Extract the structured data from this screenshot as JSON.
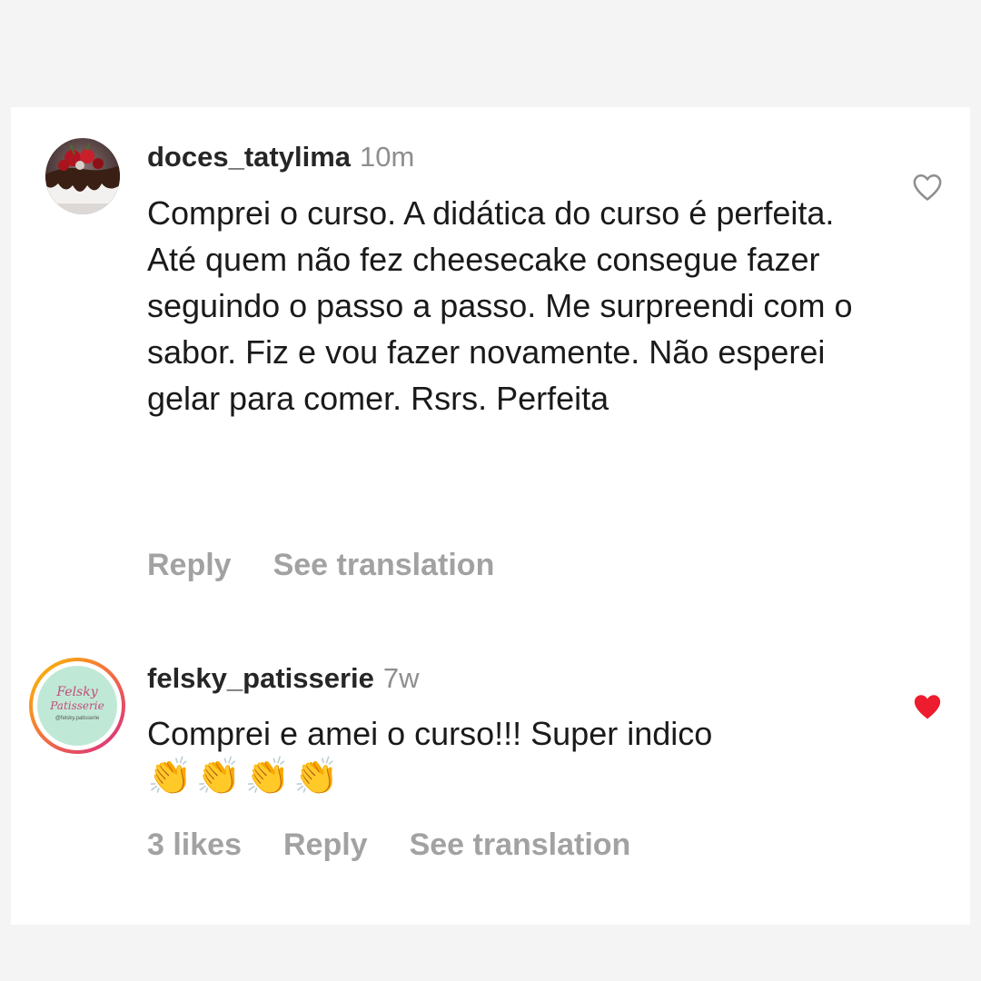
{
  "comments": [
    {
      "username": "doces_tatylima",
      "time": "10m",
      "text": "Comprei o curso. A didática do curso é perfeita. Até quem não fez cheesecake consegue fazer seguindo o passo a passo. Me surpreendi com o sabor. Fiz e vou fazer novamente. Não esperei gelar para comer. Rsrs. Perfeita",
      "reply_label": "Reply",
      "translate_label": "See translation",
      "liked": false,
      "avatar_icon": "cake-avatar-icon"
    },
    {
      "username": "felsky_patisserie",
      "time": "7w",
      "text": "Comprei e amei o curso!!! Super indico",
      "emoji": "👏👏👏👏",
      "likes_label": "3 likes",
      "reply_label": "Reply",
      "translate_label": "See translation",
      "liked": true,
      "avatar_logo": {
        "line1": "Felsky",
        "line2": "Patisserie",
        "handle": "@felsky.patisserie"
      },
      "avatar_icon": "felsky-logo-icon"
    }
  ],
  "colors": {
    "heart_liked": "#ed1c2e",
    "heart_outline": "#8e8e8e",
    "muted_text": "#a2a2a2",
    "story_ring_start": "#f9c200",
    "story_ring_end": "#d62a8a"
  }
}
